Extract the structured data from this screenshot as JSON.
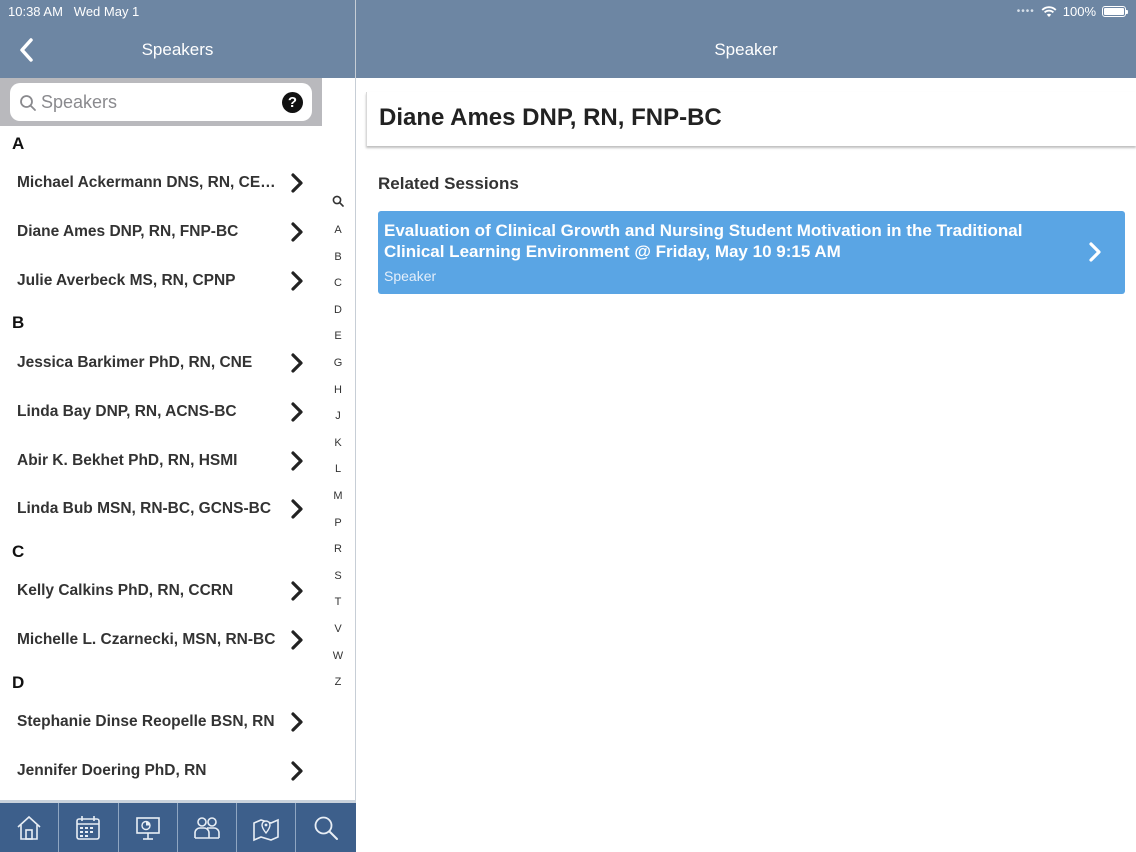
{
  "status": {
    "time": "10:38 AM",
    "date": "Wed May 1",
    "battery": "100%",
    "battery_level": 1.0
  },
  "nav": {
    "left_title": "Speakers",
    "right_title": "Speaker"
  },
  "search": {
    "placeholder": "Speakers",
    "help": "?"
  },
  "sections": [
    {
      "letter": "A",
      "speakers": [
        "Michael Ackermann DNS, RN, CE…",
        "Diane Ames DNP, RN, FNP-BC",
        "Julie Averbeck MS, RN, CPNP"
      ]
    },
    {
      "letter": "B",
      "speakers": [
        "Jessica Barkimer PhD, RN, CNE",
        "Linda Bay DNP, RN, ACNS-BC",
        "Abir K. Bekhet PhD, RN, HSMI",
        "Linda Bub MSN, RN-BC, GCNS-BC"
      ]
    },
    {
      "letter": "C",
      "speakers": [
        "Kelly Calkins PhD, RN, CCRN",
        "Michelle L. Czarnecki, MSN, RN-BC"
      ]
    },
    {
      "letter": "D",
      "speakers": [
        "Stephanie Dinse Reopelle BSN, RN",
        "Jennifer Doering PhD, RN"
      ]
    }
  ],
  "index": [
    "A",
    "B",
    "C",
    "D",
    "E",
    "G",
    "H",
    "J",
    "K",
    "L",
    "M",
    "P",
    "R",
    "S",
    "T",
    "V",
    "W",
    "Z"
  ],
  "tabs": [
    {
      "icon": "home-icon"
    },
    {
      "icon": "calendar-icon"
    },
    {
      "icon": "presentation-icon"
    },
    {
      "icon": "people-icon"
    },
    {
      "icon": "map-icon"
    },
    {
      "icon": "search-icon"
    }
  ],
  "detail": {
    "name": "Diane Ames DNP, RN, FNP-BC",
    "related_title": "Related Sessions",
    "sessions": [
      {
        "title": "Evaluation of Clinical Growth and Nursing Student Motivation in the Traditional Clinical Learning Environment @ Friday, May 10 9:15 AM",
        "role": "Speaker"
      }
    ]
  },
  "colors": {
    "nav_bar": "#6d86a3",
    "tab_bar": "#3d5f8b",
    "session_card": "#5aa5e4"
  }
}
